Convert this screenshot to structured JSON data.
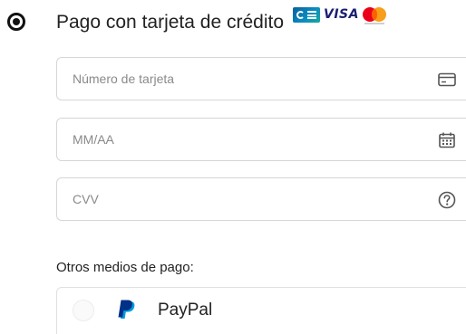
{
  "credit_card_option": {
    "title": "Pago con tarjeta de crédito",
    "selected": true,
    "logos": [
      "cb-logo",
      "visa-logo",
      "mastercard-logo"
    ],
    "visa_text": "VISA"
  },
  "fields": {
    "card_number": {
      "placeholder": "Número de tarjeta",
      "value": "",
      "icon": "credit-card-icon"
    },
    "expiry": {
      "placeholder": "MM/AA",
      "value": "",
      "icon": "calendar-icon"
    },
    "cvv": {
      "placeholder": "CVV",
      "value": "",
      "icon": "help-circle-icon"
    }
  },
  "other_methods": {
    "label": "Otros medios de pago:",
    "options": [
      {
        "label": "PayPal",
        "selected": false,
        "icon": "paypal-logo"
      }
    ]
  },
  "colors": {
    "text": "#222222",
    "placeholder": "#8a8a8a",
    "border": "#d6d6d6",
    "icon": "#555555",
    "paypal_dark": "#003087",
    "paypal_light": "#009cde"
  }
}
